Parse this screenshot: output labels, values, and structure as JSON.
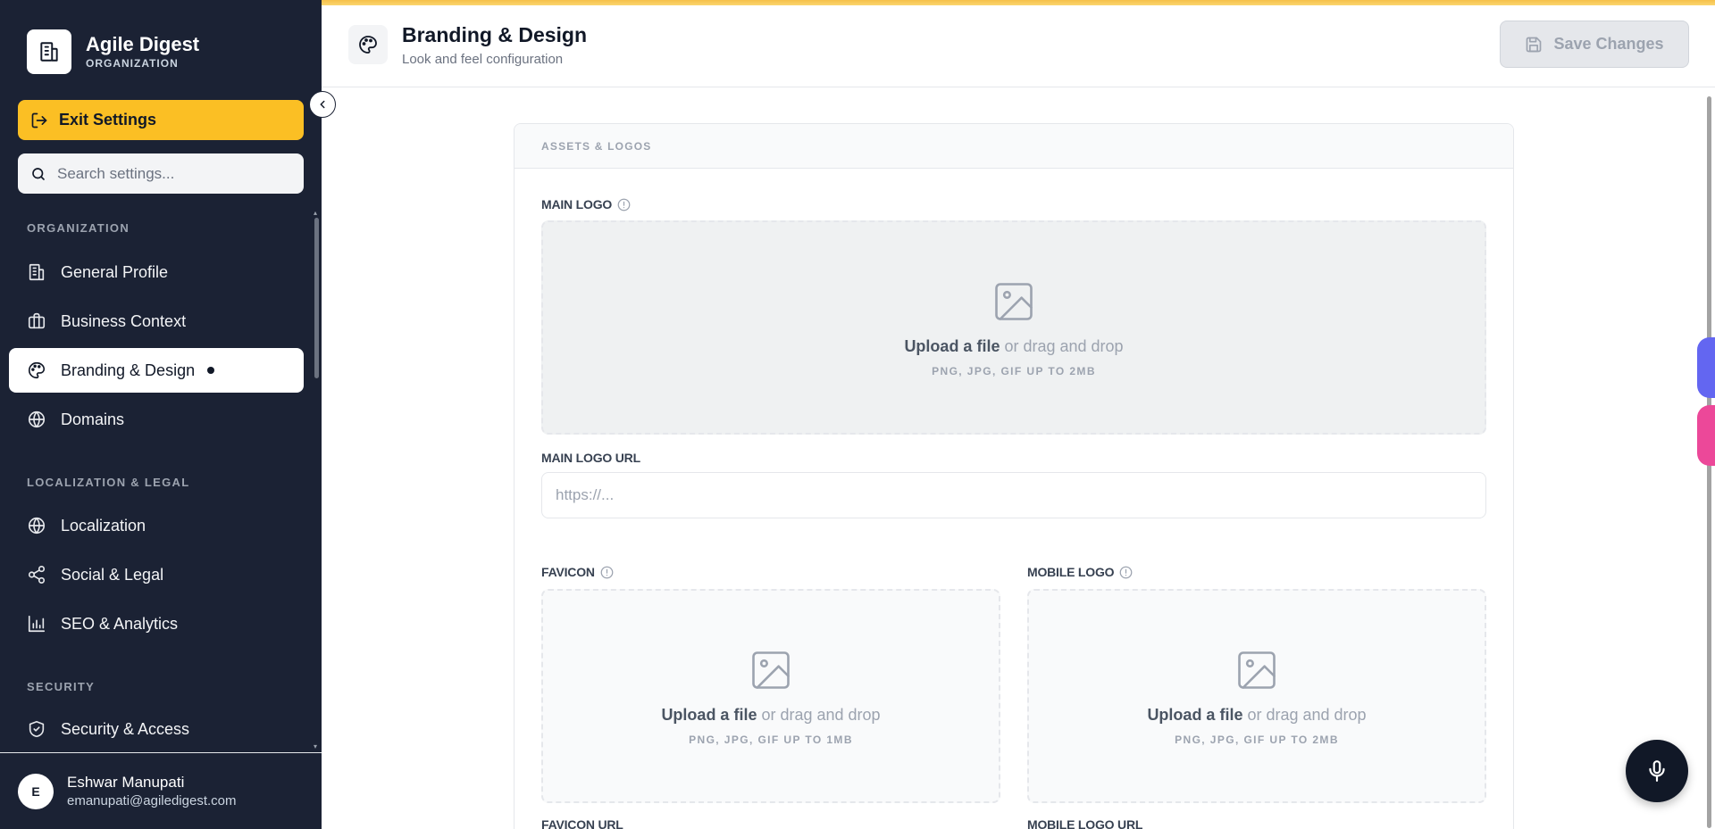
{
  "app": {
    "name": "Agile Digest",
    "subtitle": "ORGANIZATION"
  },
  "sidebar": {
    "exit_label": "Exit Settings",
    "search_placeholder": "Search settings...",
    "sections": [
      {
        "title": "ORGANIZATION",
        "items": [
          {
            "label": "General Profile",
            "icon": "building-icon"
          },
          {
            "label": "Business Context",
            "icon": "briefcase-icon"
          },
          {
            "label": "Branding & Design",
            "icon": "palette-icon",
            "active": true
          },
          {
            "label": "Domains",
            "icon": "globe-icon"
          }
        ]
      },
      {
        "title": "LOCALIZATION & LEGAL",
        "items": [
          {
            "label": "Localization",
            "icon": "globe-icon"
          },
          {
            "label": "Social & Legal",
            "icon": "share-icon"
          },
          {
            "label": "SEO & Analytics",
            "icon": "bar-chart-icon"
          }
        ]
      },
      {
        "title": "SECURITY",
        "items": [
          {
            "label": "Security & Access",
            "icon": "shield-icon"
          }
        ]
      }
    ],
    "user": {
      "initial": "E",
      "name": "Eshwar Manupati",
      "email": "emanupati@agiledigest.com"
    }
  },
  "header": {
    "title": "Branding & Design",
    "subtitle": "Look and feel configuration",
    "save_label": "Save Changes"
  },
  "card": {
    "section_title": "ASSETS & LOGOS",
    "main_logo": {
      "label": "MAIN LOGO",
      "upload_bold": "Upload a file",
      "upload_rest": " or drag and drop",
      "hint": "PNG, JPG, GIF UP TO 2MB"
    },
    "main_logo_url": {
      "label": "MAIN LOGO URL",
      "placeholder": "https://..."
    },
    "favicon": {
      "label": "FAVICON",
      "upload_bold": "Upload a file",
      "upload_rest": " or drag and drop",
      "hint": "PNG, JPG, GIF UP TO 1MB"
    },
    "mobile_logo": {
      "label": "MOBILE LOGO",
      "upload_bold": "Upload a file",
      "upload_rest": " or drag and drop",
      "hint": "PNG, JPG, GIF UP TO 2MB"
    },
    "favicon_url": {
      "label": "FAVICON URL"
    },
    "mobile_logo_url": {
      "label": "MOBILE LOGO URL"
    }
  },
  "colors": {
    "sidebar_bg": "#1b2234",
    "accent": "#fbbf24",
    "purple_tab": "#6366f1",
    "pink_tab": "#ec4899"
  }
}
